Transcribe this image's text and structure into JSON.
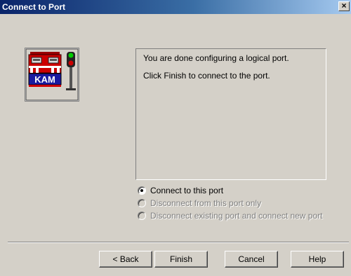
{
  "window": {
    "title": "Connect to Port",
    "close_glyph": "×"
  },
  "logo": {
    "icon": "kam-locomotive-signal-icon",
    "text": "KAM"
  },
  "panel": {
    "line1": "You are done configuring a logical port.",
    "line2": "Click Finish to connect to the port."
  },
  "options": [
    {
      "label": "Connect to this port",
      "selected": true,
      "enabled": true
    },
    {
      "label": "Disconnect from this port only",
      "selected": false,
      "enabled": false
    },
    {
      "label": "Disconnect existing port and connect new port",
      "selected": false,
      "enabled": false
    }
  ],
  "buttons": {
    "back": "< Back",
    "finish": "Finish",
    "cancel": "Cancel",
    "help": "Help"
  },
  "colors": {
    "title_start": "#0a246a",
    "title_end": "#a6caf0",
    "face": "#d4d0c8",
    "logo_red": "#cc0000",
    "logo_blue": "#1a1aa0"
  }
}
